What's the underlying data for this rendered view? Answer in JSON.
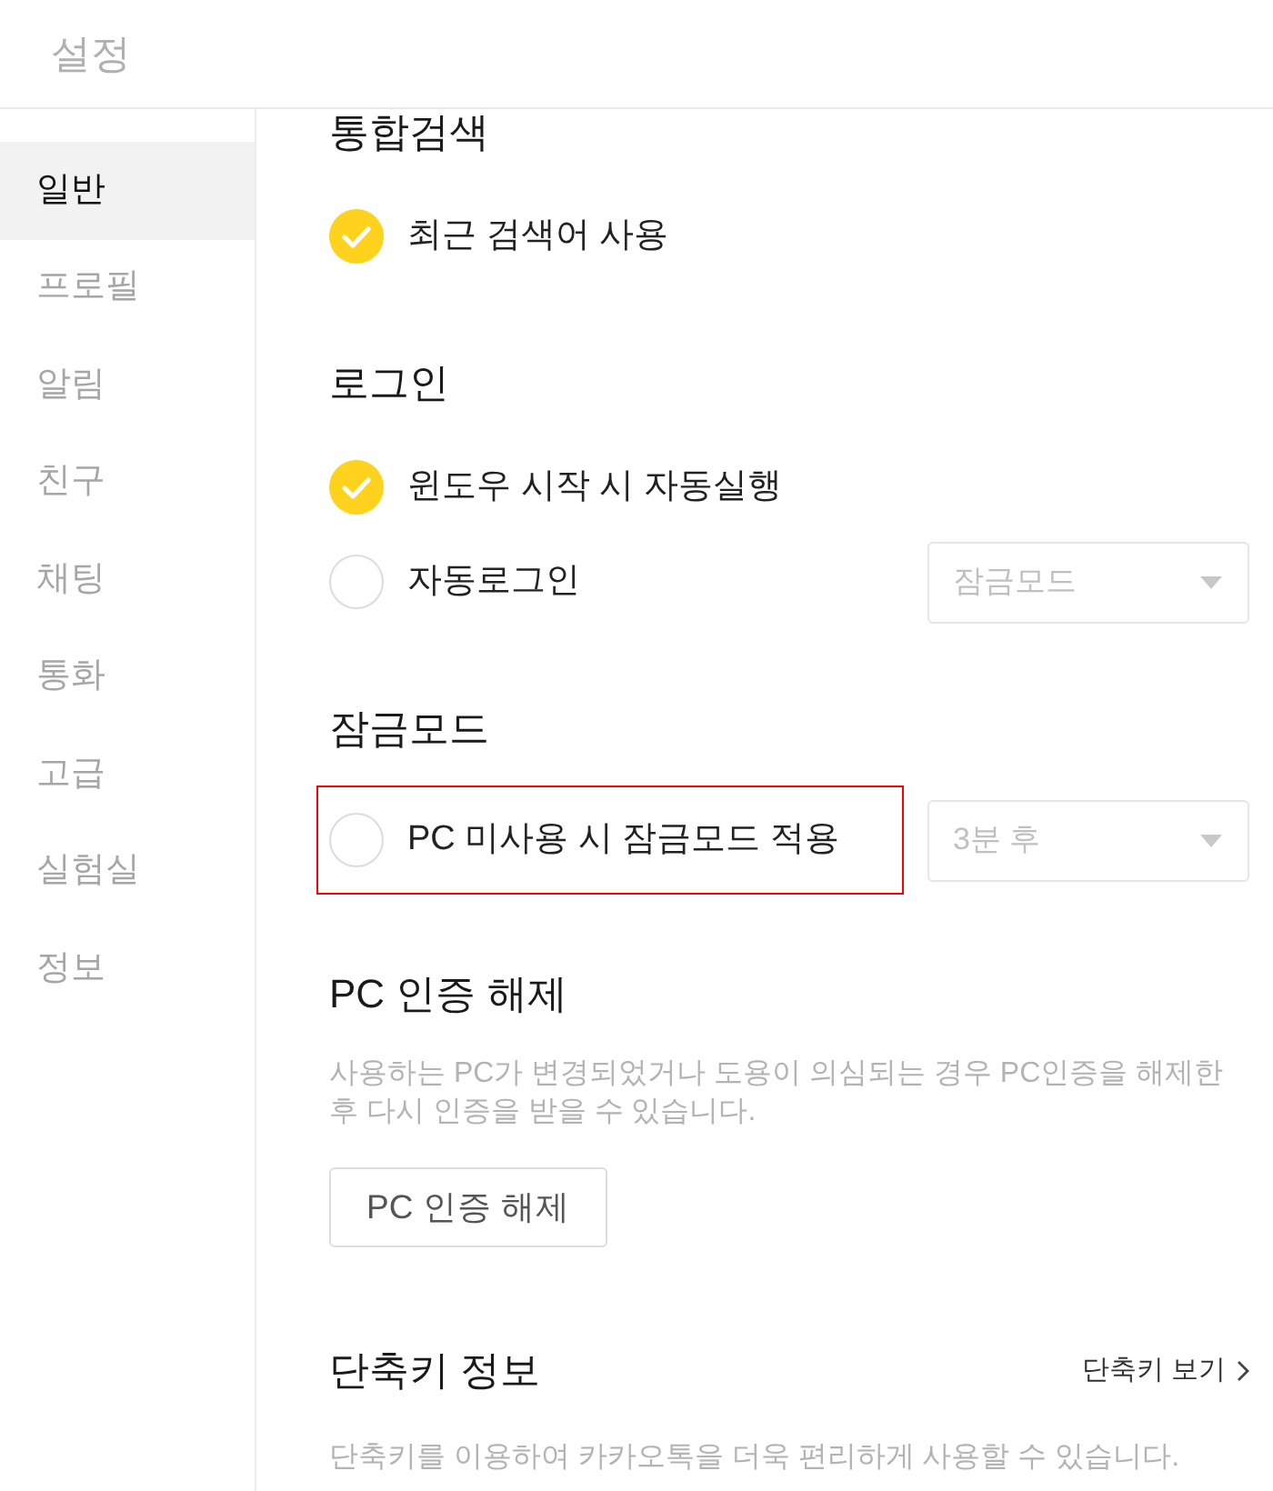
{
  "window": {
    "title": "설정"
  },
  "sidebar": {
    "items": [
      {
        "label": "일반",
        "selected": true
      },
      {
        "label": "프로필",
        "selected": false
      },
      {
        "label": "알림",
        "selected": false
      },
      {
        "label": "친구",
        "selected": false
      },
      {
        "label": "채팅",
        "selected": false
      },
      {
        "label": "통화",
        "selected": false
      },
      {
        "label": "고급",
        "selected": false
      },
      {
        "label": "실험실",
        "selected": false
      },
      {
        "label": "정보",
        "selected": false
      }
    ]
  },
  "sections": [
    {
      "kind": "options",
      "title": "통합검색",
      "options": [
        {
          "label": "최근 검색어 사용",
          "checked": true,
          "highlighted": false
        }
      ]
    },
    {
      "kind": "options",
      "title": "로그인",
      "options": [
        {
          "label": "윈도우 시작 시 자동실행",
          "checked": true,
          "highlighted": false
        },
        {
          "label": "자동로그인",
          "checked": false,
          "highlighted": false,
          "dropdown": {
            "value": "잠금모드",
            "disabled": true
          }
        }
      ]
    },
    {
      "kind": "options",
      "title": "잠금모드",
      "options": [
        {
          "label": "PC 미사용 시 잠금모드 적용",
          "checked": false,
          "highlighted": true,
          "dropdown": {
            "value": "3분 후",
            "disabled": true
          }
        }
      ]
    },
    {
      "kind": "action",
      "title": "PC 인증 해제",
      "description": "사용하는 PC가 변경되었거나 도용이 의심되는 경우 PC인증을 해제한 후 다시 인증을 받을 수 있습니다.",
      "button": "PC 인증 해제"
    },
    {
      "kind": "info",
      "title": "단축키 정보",
      "link": "단축키 보기",
      "description": "단축키를 이용하여 카카오톡을 더욱 편리하게 사용할 수 있습니다."
    }
  ]
}
